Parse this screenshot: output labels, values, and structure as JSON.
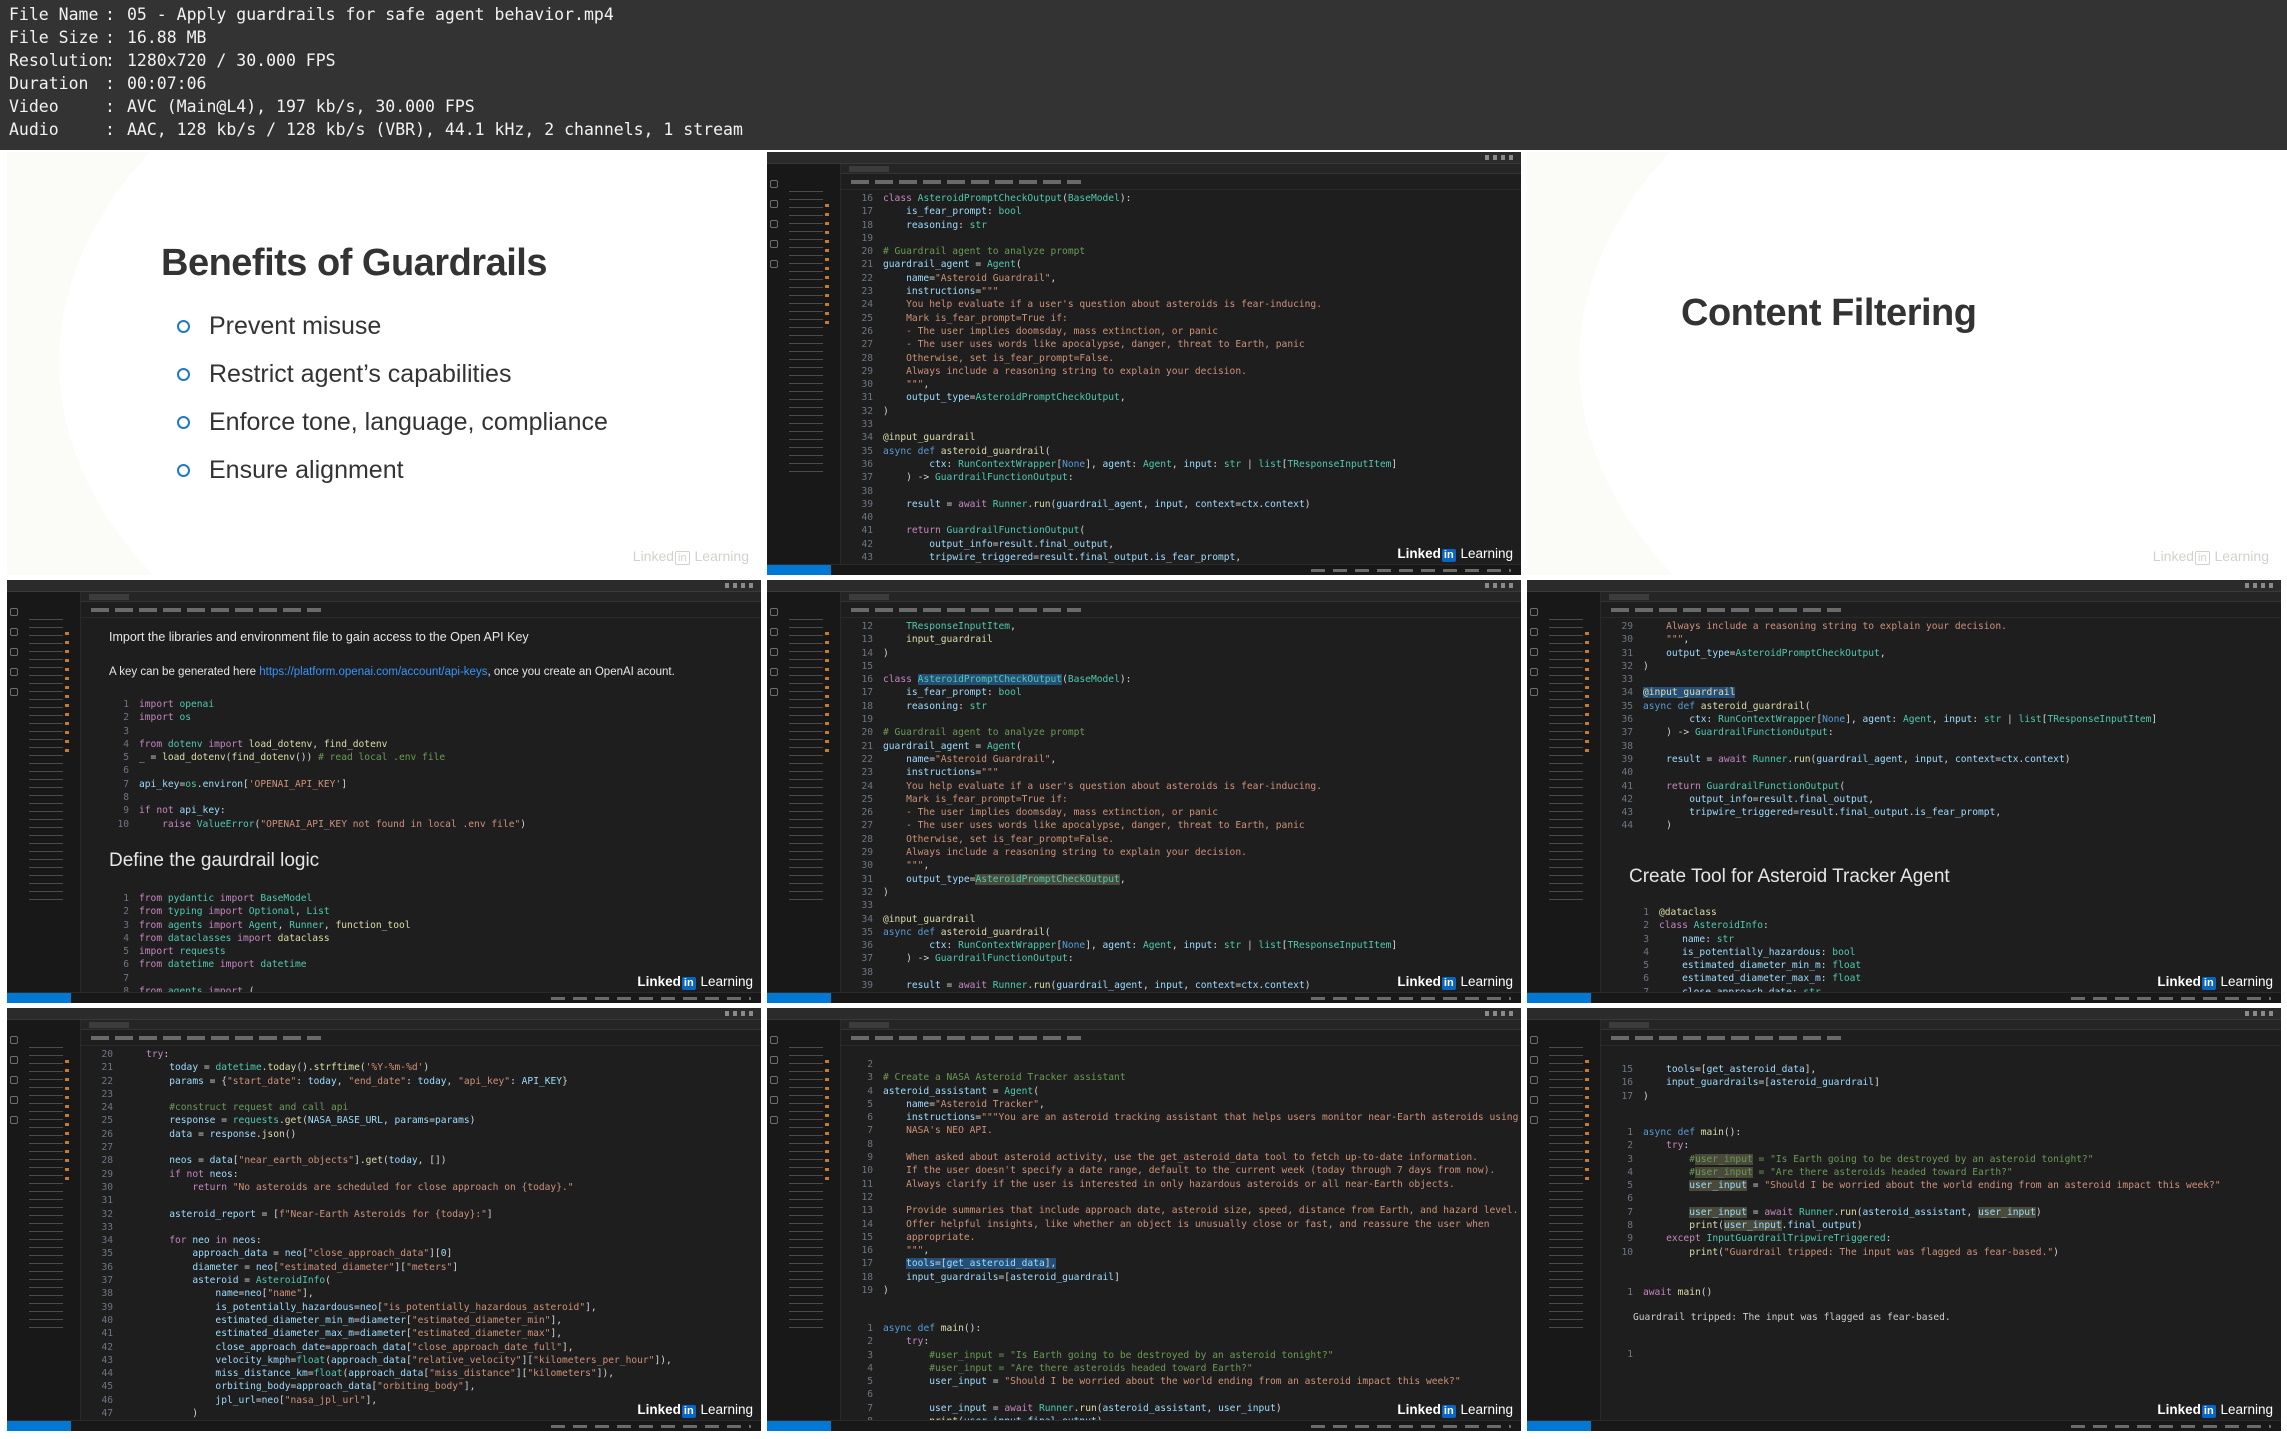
{
  "file_info": [
    {
      "key": "File Name",
      "value": "05 - Apply guardrails for safe agent behavior.mp4"
    },
    {
      "key": "File Size",
      "value": "16.88 MB"
    },
    {
      "key": "Resolution",
      "value": "1280x720 / 30.000 FPS"
    },
    {
      "key": "Duration",
      "value": "00:07:06"
    },
    {
      "key": "Video",
      "value": "AVC (Main@L4), 197 kb/s, 30.000 FPS"
    },
    {
      "key": "Audio",
      "value": "AAC, 128 kb/s / 128 kb/s (VBR), 44.1 kHz, 2 channels, 1 stream"
    }
  ],
  "separator": ":",
  "slide1": {
    "title": "Benefits of Guardrails",
    "bullets": [
      "Prevent misuse",
      "Restrict agent’s capabilities",
      "Enforce tone, language, compliance",
      "Ensure alignment"
    ]
  },
  "slide3": {
    "title": "Content Filtering"
  },
  "watermark": {
    "pre": "Linked",
    "badge": "in",
    "post": " Learning"
  },
  "tile4": {
    "para1": "Import the libraries and environment file to gain access to the Open API Key",
    "para2_pre": "A key can be generated here ",
    "para2_link": "https://platform.openai.com/account/api-keys",
    "para2_post": ", once you create an OpenAI acount.",
    "heading": "Define the gaurdrail logic"
  },
  "tile6": {
    "heading": "Create Tool for Asteroid Tracker Agent"
  },
  "tile9": {
    "output": "Guardrail tripped: The input was flagged as fear-based."
  }
}
